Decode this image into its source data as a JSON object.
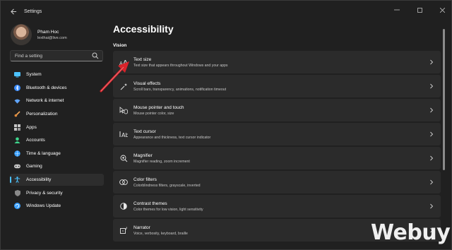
{
  "window": {
    "title": "Settings",
    "controls": [
      "minimize",
      "maximize",
      "close"
    ]
  },
  "user": {
    "name": "Pham Hoc",
    "email": "lexthai@live.com"
  },
  "search": {
    "placeholder": "Find a setting"
  },
  "sidebar": {
    "items": [
      {
        "label": "System",
        "icon": "system-icon",
        "color": "#4cc2ff"
      },
      {
        "label": "Bluetooth & devices",
        "icon": "bluetooth-icon",
        "color": "#3a8cff"
      },
      {
        "label": "Network & internet",
        "icon": "wifi-icon",
        "color": "#60a5ff"
      },
      {
        "label": "Personalization",
        "icon": "brush-icon",
        "color": "#f2a65a"
      },
      {
        "label": "Apps",
        "icon": "apps-icon",
        "color": "#c8c8c8"
      },
      {
        "label": "Accounts",
        "icon": "accounts-icon",
        "color": "#3fd68c"
      },
      {
        "label": "Time & language",
        "icon": "globe-icon",
        "color": "#3aa0ff"
      },
      {
        "label": "Gaming",
        "icon": "gaming-icon",
        "color": "#c8c8c8"
      },
      {
        "label": "Accessibility",
        "icon": "accessibility-icon",
        "color": "#4cc2ff",
        "active": true
      },
      {
        "label": "Privacy & security",
        "icon": "shield-icon",
        "color": "#8a8a8a"
      },
      {
        "label": "Windows Update",
        "icon": "update-icon",
        "color": "#3aa0ff"
      }
    ]
  },
  "main": {
    "title": "Accessibility",
    "section": "Vision",
    "cards": [
      {
        "title": "Text size",
        "subtitle": "Text size that appears throughout Windows and your apps",
        "icon": "text-size-icon"
      },
      {
        "title": "Visual effects",
        "subtitle": "Scroll bars, transparency, animations, notification timeout",
        "icon": "visual-effects-icon"
      },
      {
        "title": "Mouse pointer and touch",
        "subtitle": "Mouse pointer color, size",
        "icon": "mouse-pointer-icon"
      },
      {
        "title": "Text cursor",
        "subtitle": "Appearance and thickness, text cursor indicator",
        "icon": "text-cursor-icon"
      },
      {
        "title": "Magnifier",
        "subtitle": "Magnifier reading, zoom increment",
        "icon": "magnifier-icon"
      },
      {
        "title": "Color filters",
        "subtitle": "Colorblindness filters, grayscale, inverted",
        "icon": "color-filters-icon"
      },
      {
        "title": "Contrast themes",
        "subtitle": "Color themes for low vision, light sensitivity",
        "icon": "contrast-icon"
      },
      {
        "title": "Narrator",
        "subtitle": "Voice, verbosity, keyboard, braille",
        "icon": "narrator-icon"
      }
    ]
  },
  "watermark": "Webuy",
  "colors": {
    "accent": "#4cc2ff",
    "annotation": "#d8232a"
  }
}
